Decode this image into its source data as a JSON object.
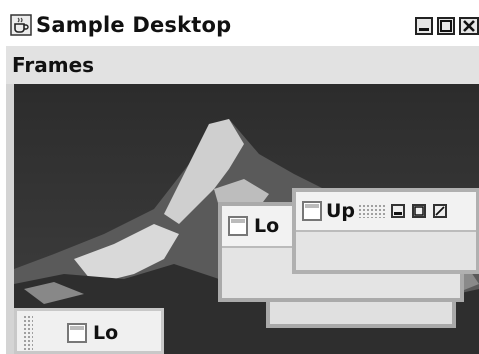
{
  "window": {
    "title": "Sample Desktop",
    "icon": "cup-icon",
    "controls": [
      "minimize-icon",
      "maximize-icon",
      "close-icon"
    ]
  },
  "menubar": {
    "items": [
      {
        "label": "Frames"
      }
    ]
  },
  "desktop": {
    "background": "mountain photograph"
  },
  "internal_frames": [
    {
      "title": "Lo",
      "state": "open"
    },
    {
      "title": "Up",
      "state": "open",
      "controls": [
        "minimize-icon",
        "maximize-icon",
        "close-icon"
      ]
    },
    {
      "title": "Lo",
      "state": "iconified"
    }
  ]
}
